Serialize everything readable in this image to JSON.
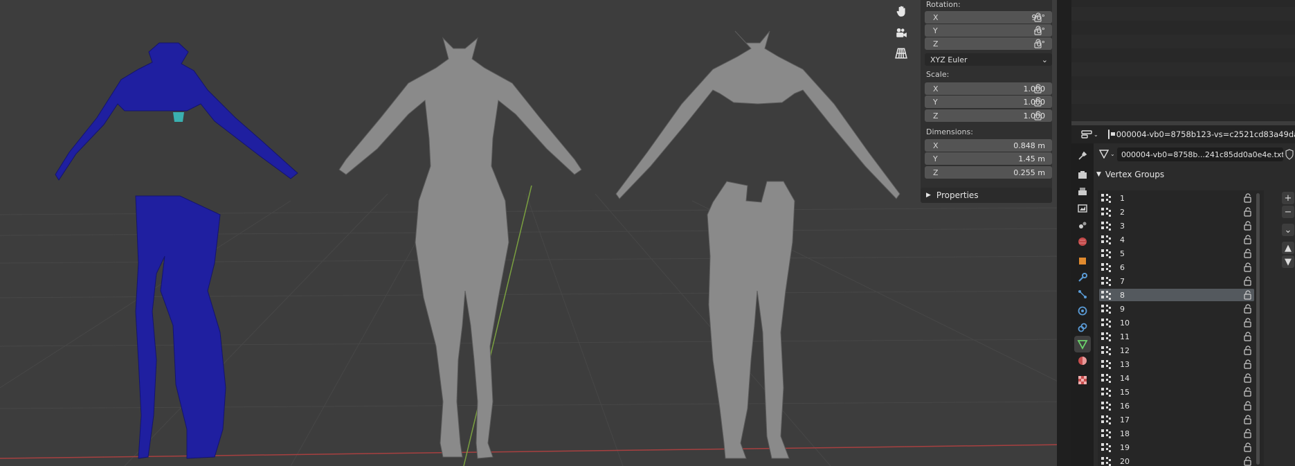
{
  "viewport": {
    "tools": [
      "hand-icon",
      "camera-icon",
      "grid-icon"
    ]
  },
  "npanel": {
    "rotation_label": "Rotation:",
    "rotation": [
      {
        "axis": "X",
        "value": "90°"
      },
      {
        "axis": "Y",
        "value": "-0°"
      },
      {
        "axis": "Z",
        "value": "0°"
      }
    ],
    "rotation_mode": "XYZ Euler",
    "scale_label": "Scale:",
    "scale": [
      {
        "axis": "X",
        "value": "1.000"
      },
      {
        "axis": "Y",
        "value": "1.000"
      },
      {
        "axis": "Z",
        "value": "1.000"
      }
    ],
    "dimensions_label": "Dimensions:",
    "dimensions": [
      {
        "axis": "X",
        "value": "0.848 m"
      },
      {
        "axis": "Y",
        "value": "1.45 m"
      },
      {
        "axis": "Z",
        "value": "0.255 m"
      }
    ],
    "properties_label": "Properties"
  },
  "properties": {
    "object_name": "000004-vb0=8758b123-vs=c2521cd83a49dal",
    "mesh_name": "000004-vb0=8758b...241c85dd0a0e4e.txt",
    "section_title": "Vertex Groups",
    "vertex_groups": [
      "1",
      "2",
      "3",
      "4",
      "5",
      "6",
      "7",
      "8",
      "9",
      "10",
      "11",
      "12",
      "13",
      "14",
      "15",
      "16",
      "17",
      "18",
      "19",
      "20"
    ],
    "selected_group": "8",
    "side_buttons": [
      "+",
      "−",
      "⌄",
      "▲",
      "▼"
    ]
  },
  "colors": {
    "viewport_bg": "#3d3d3d",
    "selected_row": "#54595e",
    "mesh_blue": "#1f1fa0",
    "mesh_grey": "#8a8a8a",
    "x_axis": "#b04040",
    "y_axis": "#7aa040"
  }
}
